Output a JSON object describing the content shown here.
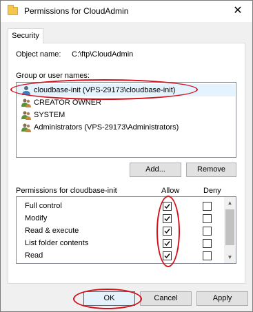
{
  "window": {
    "title": "Permissions for CloudAdmin",
    "close_glyph": "✕"
  },
  "tabs": [
    {
      "label": "Security"
    }
  ],
  "object": {
    "label": "Object name:",
    "value": "C:\\ftp\\CloudAdmin"
  },
  "group": {
    "label": "Group or user names:",
    "users": [
      {
        "name": "cloudbase-init (VPS-29173\\cloudbase-init)",
        "icon": "user-icon",
        "selected": true
      },
      {
        "name": "CREATOR OWNER",
        "icon": "users-group-icon"
      },
      {
        "name": "SYSTEM",
        "icon": "users-group-icon"
      },
      {
        "name": "Administrators (VPS-29173\\Administrators)",
        "icon": "users-group-icon"
      }
    ]
  },
  "buttons": {
    "add": "Add...",
    "remove": "Remove",
    "ok": "OK",
    "cancel": "Cancel",
    "apply": "Apply"
  },
  "permissions": {
    "label": "Permissions for cloudbase-init",
    "allow_header": "Allow",
    "deny_header": "Deny",
    "rows": [
      {
        "name": "Full control",
        "allow": true,
        "deny": false
      },
      {
        "name": "Modify",
        "allow": true,
        "deny": false
      },
      {
        "name": "Read & execute",
        "allow": true,
        "deny": false
      },
      {
        "name": "List folder contents",
        "allow": true,
        "deny": false
      },
      {
        "name": "Read",
        "allow": true,
        "deny": false
      }
    ]
  },
  "annotation_color": "#d4101c",
  "accent_color": "#0078d7"
}
